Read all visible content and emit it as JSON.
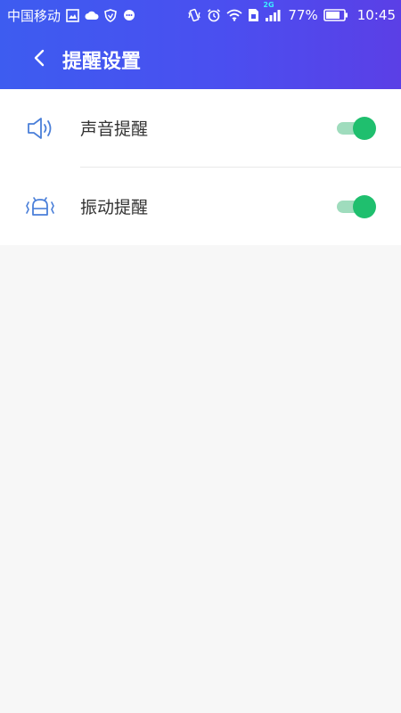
{
  "status_bar": {
    "carrier": "中国移动",
    "network_badge": "2G",
    "battery_percent": "77%",
    "time": "10:45",
    "icons": [
      "image-icon",
      "cloud-icon",
      "shield-icon",
      "chat-icon",
      "vibrate-icon",
      "alarm-icon",
      "wifi-icon",
      "sim-icon",
      "signal-icon",
      "battery-icon"
    ]
  },
  "header": {
    "title": "提醒设置",
    "back_icon": "chevron-left-icon"
  },
  "settings": {
    "items": [
      {
        "label": "声音提醒",
        "icon": "speaker-icon",
        "enabled": true
      },
      {
        "label": "振动提醒",
        "icon": "vibration-icon",
        "enabled": true
      }
    ]
  },
  "colors": {
    "header_start": "#3d5cf0",
    "header_end": "#5b3fe6",
    "toggle_on": "#1fbf6e",
    "toggle_track": "#9fdcbd",
    "icon_blue": "#4a7fd9"
  }
}
